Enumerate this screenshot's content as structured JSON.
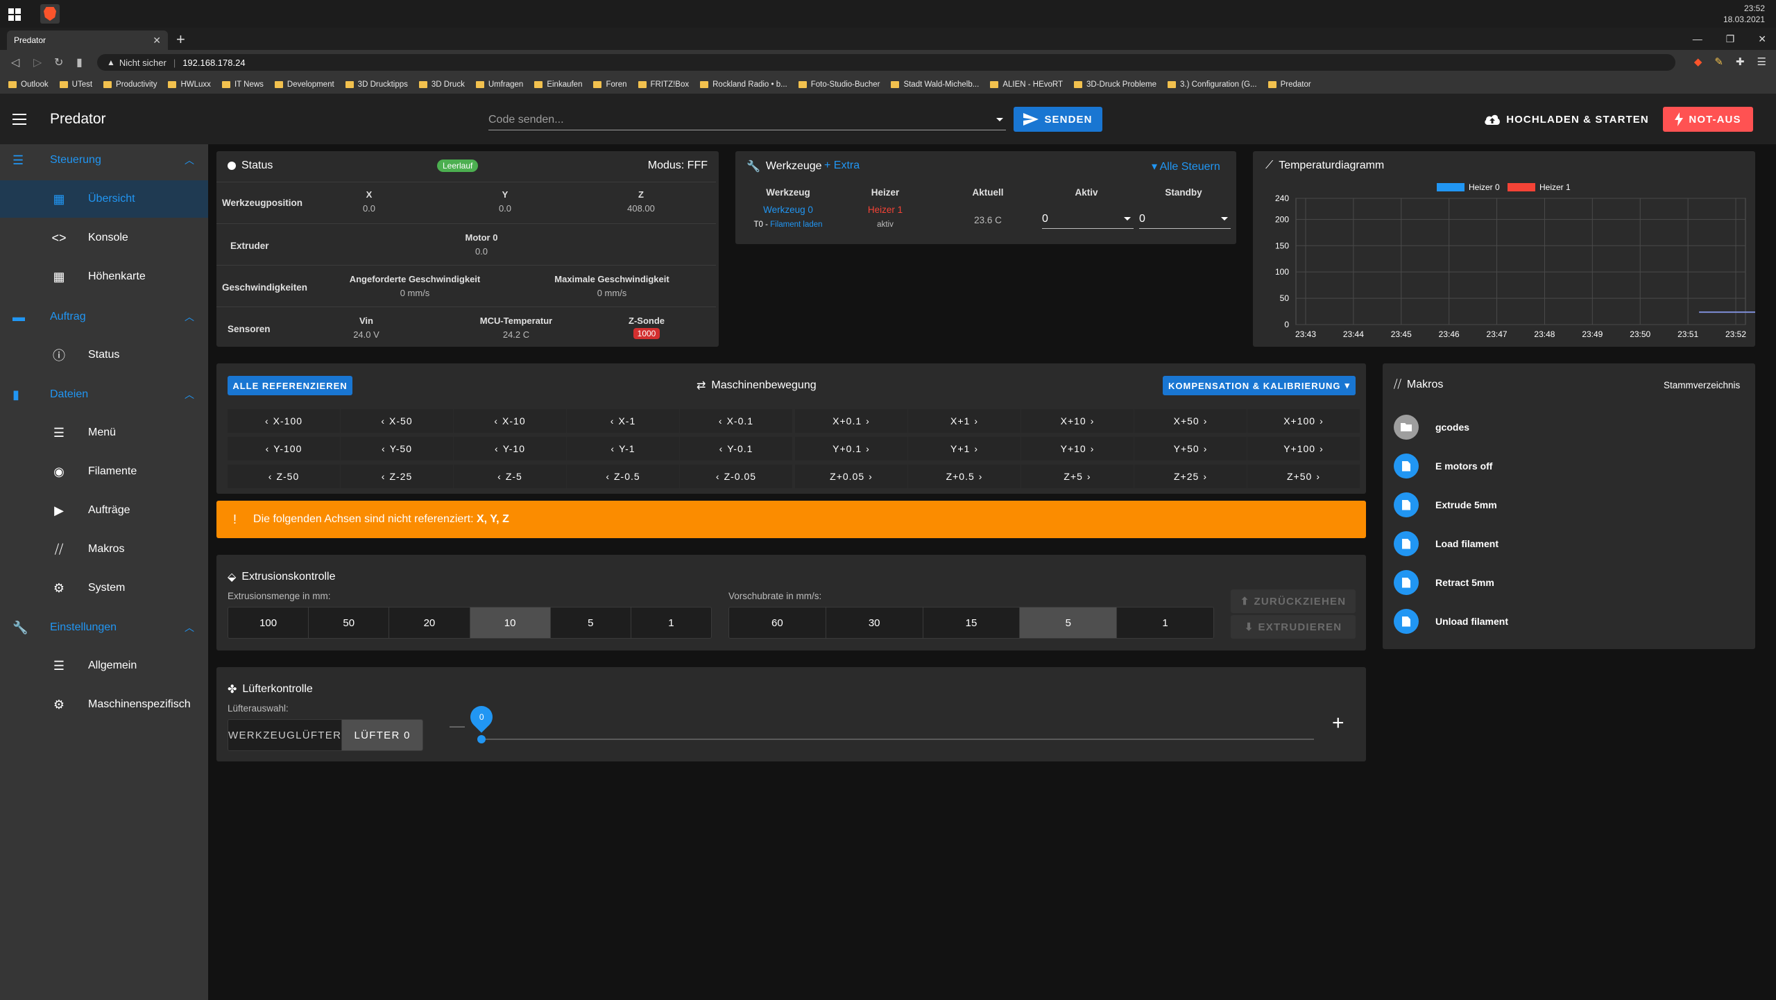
{
  "os": {
    "clock_time": "23:52",
    "clock_date": "18.03.2021"
  },
  "browser": {
    "tab_title": "Predator",
    "url_warning": "Nicht sicher",
    "url": "192.168.178.24",
    "bookmarks": [
      "Outlook",
      "UTest",
      "Productivity",
      "HWLuxx",
      "IT News",
      "Development",
      "3D Drucktipps",
      "3D Druck",
      "Umfragen",
      "Einkaufen",
      "Foren",
      "FRITZ!Box",
      "Rockland Radio • b...",
      "Foto-Studio-Bucher",
      "Stadt Wald-Michelb...",
      "ALIEN - HEvoRT",
      "3D-Druck Probleme",
      "3.) Configuration (G...",
      "Predator"
    ]
  },
  "app": {
    "title": "Predator",
    "code_placeholder": "Code senden...",
    "send_label": "SENDEN",
    "upload_label": "HOCHLADEN & STARTEN",
    "estop_label": "NOT-AUS"
  },
  "sidebar": {
    "groups": [
      {
        "label": "Steuerung",
        "items": [
          {
            "label": "Übersicht"
          },
          {
            "label": "Konsole"
          },
          {
            "label": "Höhenkarte"
          }
        ]
      },
      {
        "label": "Auftrag",
        "items": [
          {
            "label": "Status"
          }
        ]
      },
      {
        "label": "Dateien",
        "items": [
          {
            "label": "Menü"
          },
          {
            "label": "Filamente"
          },
          {
            "label": "Aufträge"
          },
          {
            "label": "Makros"
          },
          {
            "label": "System"
          }
        ]
      },
      {
        "label": "Einstellungen",
        "items": [
          {
            "label": "Allgemein"
          },
          {
            "label": "Maschinenspezifisch"
          }
        ]
      }
    ]
  },
  "status": {
    "title": "Status",
    "state_chip": "Leerlauf",
    "mode": "Modus: FFF",
    "tool_position_label": "Werkzeugposition",
    "axes": [
      {
        "name": "X",
        "value": "0.0"
      },
      {
        "name": "Y",
        "value": "0.0"
      },
      {
        "name": "Z",
        "value": "408.00"
      }
    ],
    "extruder_label": "Extruder",
    "motor_name": "Motor 0",
    "motor_value": "0.0",
    "speeds_label": "Geschwindigkeiten",
    "requested_speed_label": "Angeforderte Geschwindigkeit",
    "requested_speed_value": "0 mm/s",
    "max_speed_label": "Maximale Geschwindigkeit",
    "max_speed_value": "0 mm/s",
    "sensors_label": "Sensoren",
    "vin_label": "Vin",
    "vin_value": "24.0 V",
    "mcu_label": "MCU-Temperatur",
    "mcu_value": "24.2 C",
    "zprobe_label": "Z-Sonde",
    "zprobe_value": "1000"
  },
  "tools": {
    "title": "Werkzeuge",
    "extra_label": "Extra",
    "all_control_label": "Alle Steuern",
    "headers": [
      "Werkzeug",
      "Heizer",
      "Aktuell",
      "Aktiv",
      "Standby"
    ],
    "tool_name": "Werkzeug 0",
    "tool_sub_prefix": "T0 -",
    "tool_sub_link": "Filament laden",
    "heater_name": "Heizer 1",
    "heater_state": "aktiv",
    "current_temp": "23.6 C",
    "active_value": "0",
    "standby_value": "0"
  },
  "temp_chart": {
    "title": "Temperaturdiagramm"
  },
  "chart_data": {
    "type": "line",
    "title": "Temperaturdiagramm",
    "xlabel": "",
    "ylabel": "",
    "ylim": [
      0,
      240
    ],
    "yticks": [
      0,
      50,
      100,
      150,
      200,
      240
    ],
    "xticks": [
      "23:43",
      "23:44",
      "23:45",
      "23:46",
      "23:47",
      "23:48",
      "23:49",
      "23:50",
      "23:51",
      "23:52"
    ],
    "legend": "top-center",
    "grid": true,
    "series": [
      {
        "name": "Heizer 0",
        "color": "#2196f3",
        "x": [
          "23:51",
          "23:52"
        ],
        "values": [
          23.6,
          23.6
        ]
      },
      {
        "name": "Heizer 1",
        "color": "#f44336",
        "x": [],
        "values": []
      }
    ]
  },
  "movement": {
    "title": "Maschinenbewegung",
    "home_all_label": "ALLE REFERENZIEREN",
    "comp_label": "KOMPENSATION & KALIBRIERUNG",
    "rows": [
      {
        "neg": [
          "X-100",
          "X-50",
          "X-10",
          "X-1",
          "X-0.1"
        ],
        "pos": [
          "X+0.1",
          "X+1",
          "X+10",
          "X+50",
          "X+100"
        ]
      },
      {
        "neg": [
          "Y-100",
          "Y-50",
          "Y-10",
          "Y-1",
          "Y-0.1"
        ],
        "pos": [
          "Y+0.1",
          "Y+1",
          "Y+10",
          "Y+50",
          "Y+100"
        ]
      },
      {
        "neg": [
          "Z-50",
          "Z-25",
          "Z-5",
          "Z-0.5",
          "Z-0.05"
        ],
        "pos": [
          "Z+0.05",
          "Z+0.5",
          "Z+5",
          "Z+25",
          "Z+50"
        ]
      }
    ]
  },
  "alert": {
    "text": "Die folgenden Achsen sind nicht referenziert:",
    "axes": "X, Y, Z"
  },
  "extrusion": {
    "title": "Extrusionskontrolle",
    "amount_label": "Extrusionsmenge in mm:",
    "amounts": [
      "100",
      "50",
      "20",
      "10",
      "5",
      "1"
    ],
    "amount_selected": "10",
    "feed_label": "Vorschubrate in mm/s:",
    "feeds": [
      "60",
      "30",
      "15",
      "5",
      "1"
    ],
    "feed_selected": "5",
    "retract_label": "ZURÜCKZIEHEN",
    "extrude_label": "EXTRUDIEREN"
  },
  "fan": {
    "title": "Lüfterkontrolle",
    "selection_label": "Lüfterauswahl:",
    "options": [
      "WERKZEUGLÜFTER",
      "LÜFTER 0"
    ],
    "selected": "LÜFTER 0",
    "value": "0",
    "value_fraction": 0
  },
  "macros": {
    "title": "Makros",
    "root_label": "Stammverzeichnis",
    "items": [
      {
        "label": "gcodes",
        "kind": "folder"
      },
      {
        "label": "E motors off",
        "kind": "file"
      },
      {
        "label": "Extrude 5mm",
        "kind": "file"
      },
      {
        "label": "Load filament",
        "kind": "file"
      },
      {
        "label": "Retract 5mm",
        "kind": "file"
      },
      {
        "label": "Unload filament",
        "kind": "file"
      }
    ]
  }
}
